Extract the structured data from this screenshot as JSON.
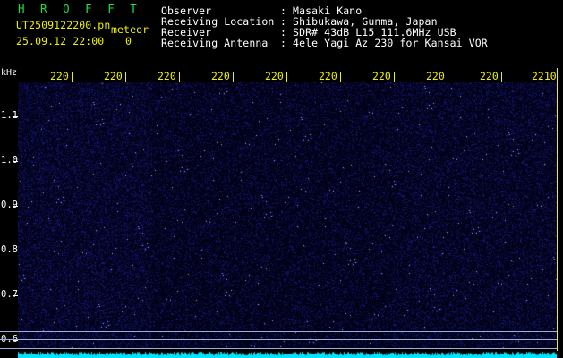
{
  "app_title": "H R O F F T",
  "file_name": "UT2509122200.pn",
  "mode_label": "meteor",
  "date_time": "25.09.12 22:00",
  "counter": "0_",
  "info": {
    "labels": [
      "Observer",
      "Receiving Location",
      "Receiver",
      "Receiving Antenna"
    ],
    "values": [
      ": Masaki Kano",
      ": Shibukawa, Gunma, Japan",
      ": SDR# 43dB L15 111.6MHz USB",
      ": 4ele Yagi Az 230 for Kansai VOR"
    ]
  },
  "time_axis": {
    "labels": [
      "220",
      "220",
      "220",
      "220",
      "220",
      "220",
      "220",
      "220",
      "220",
      "2210"
    ]
  },
  "freq_axis": {
    "unit": "kHz",
    "labels": [
      "1.1",
      "1.0",
      "0.9",
      "0.8",
      "0.7",
      "0.6"
    ]
  },
  "colors": {
    "background": "#000000",
    "waterfall_base": "#000010",
    "waterfall_noise": "#2a2aa8",
    "signal": "#00e5ff",
    "axis_text": "#f0f000",
    "title_green": "#22dd44",
    "marker_line": "#9ab0d8"
  }
}
